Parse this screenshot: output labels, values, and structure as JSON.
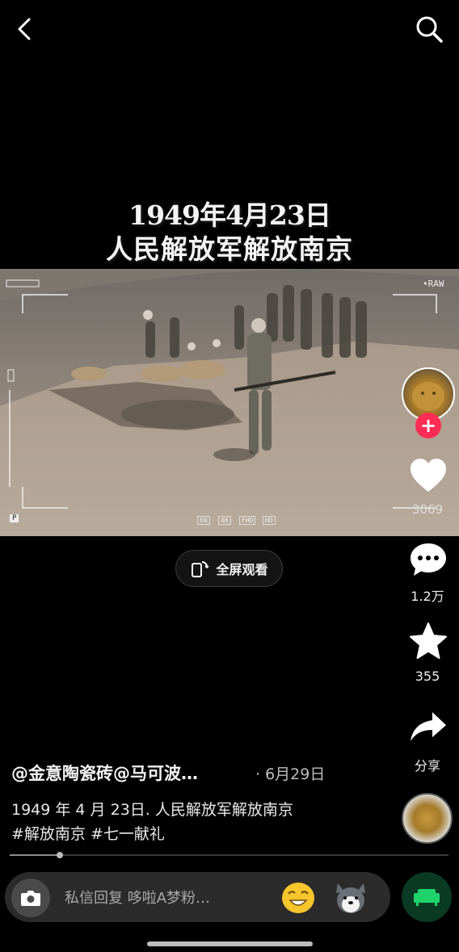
{
  "header": {
    "back_icon": "chevron-left-icon",
    "search_icon": "search-icon"
  },
  "video": {
    "title_line1": "1949年4月23日",
    "title_line2": "人民解放军解放南京",
    "hud_raw": "•RAW",
    "hud_quality_tags": [
      "60",
      "4K",
      "FHD",
      "HD"
    ],
    "hud_p": "P"
  },
  "fullscreen": {
    "label": "全屏观看",
    "icon": "rotate-screen-icon"
  },
  "rail": {
    "avatar_icon": "avatar",
    "follow_icon": "plus-icon",
    "like": {
      "icon": "heart-icon",
      "count": "3069"
    },
    "comment": {
      "icon": "comment-icon",
      "count": "1.2万"
    },
    "favorite": {
      "icon": "star-icon",
      "count": "355"
    },
    "share": {
      "icon": "share-arrow-icon",
      "label": "分享"
    }
  },
  "caption": {
    "author": "@金意陶瓷砖@马可波…",
    "date": "· 6月29日",
    "text": "1949 年 4 月 23日. 人民解放军解放南京",
    "hashtags": "#解放南京 #七一献礼"
  },
  "progress": {
    "played_fraction": 0.115
  },
  "reply": {
    "placeholder": "私信回复 哆啦A梦粉…",
    "camera_icon": "camera-icon",
    "emoji_icons": [
      "grinning-emoji-icon",
      "husky-emoji-icon"
    ],
    "sofa_icon": "sofa-icon"
  },
  "colors": {
    "background": "#000000",
    "accent_pink": "#fe2c55",
    "sofa_green": "#1fd36b"
  }
}
